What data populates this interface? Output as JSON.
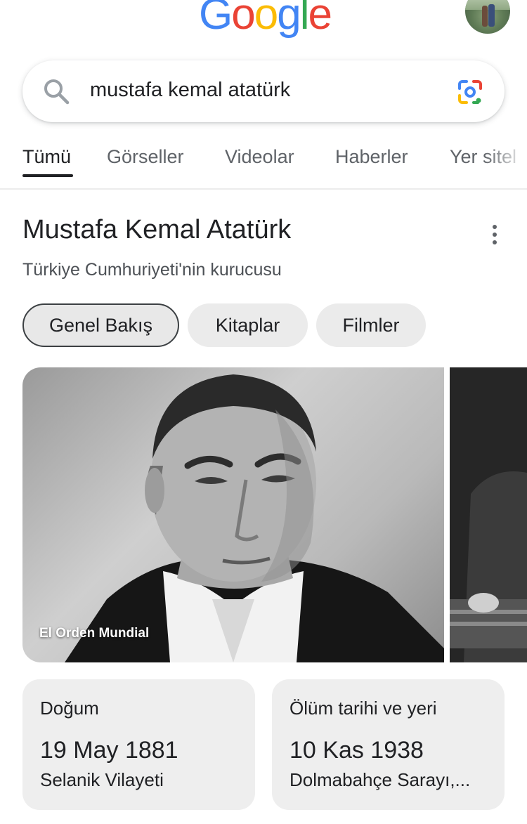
{
  "header": {
    "logo_letters": [
      {
        "char": "G",
        "color": "#4285F4"
      },
      {
        "char": "o",
        "color": "#EA4335"
      },
      {
        "char": "o",
        "color": "#FBBC05"
      },
      {
        "char": "g",
        "color": "#4285F4"
      },
      {
        "char": "l",
        "color": "#34A853"
      },
      {
        "char": "e",
        "color": "#EA4335"
      }
    ],
    "avatar_icon": "profile-avatar"
  },
  "search": {
    "query": "mustafa kemal atatürk",
    "search_icon": "magnifier-icon",
    "lens_icon": "google-lens-icon"
  },
  "tabs": [
    {
      "label": "Tümü",
      "active": true
    },
    {
      "label": "Görseller",
      "active": false
    },
    {
      "label": "Videolar",
      "active": false
    },
    {
      "label": "Haberler",
      "active": false
    },
    {
      "label": "Yer sitel",
      "active": false
    }
  ],
  "knowledge_panel": {
    "title": "Mustafa Kemal Atatürk",
    "subtitle": "Türkiye Cumhuriyeti'nin kurucusu",
    "chips": [
      {
        "label": "Genel Bakış",
        "active": true
      },
      {
        "label": "Kitaplar",
        "active": false
      },
      {
        "label": "Filmler",
        "active": false
      }
    ],
    "image_caption": "El Orden Mundial",
    "facts": [
      {
        "label": "Doğum",
        "value": "19 May 1881",
        "place": "Selanik Vilayeti"
      },
      {
        "label": "Ölüm tarihi ve yeri",
        "value": "10 Kas 1938",
        "place": "Dolmabahçe Sarayı,..."
      }
    ]
  },
  "colors": {
    "accent_text": "#202124",
    "secondary_text": "#5f6368",
    "chip_bg": "#ebebeb",
    "card_bg": "#eeeeee"
  }
}
